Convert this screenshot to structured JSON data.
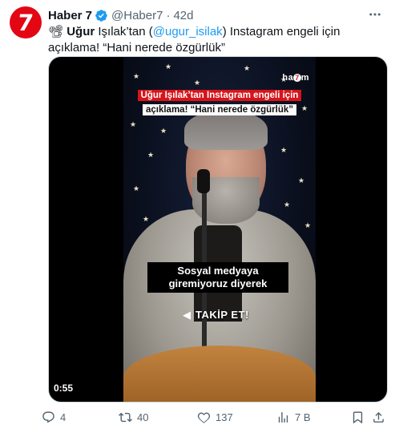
{
  "tweet": {
    "avatar_text": "7",
    "author_name": "Haber 7",
    "handle": "@Haber7",
    "separator": "·",
    "time": "42d",
    "text": {
      "emoji": "📽",
      "bold": "Uğur",
      "part1": " Işılak’tan (",
      "mention": "@ugur_isilak",
      "part2": ") Instagram engeli için açıklama! “Hani nerede özgürlük”"
    }
  },
  "video": {
    "overlay_line1": "Uğur Işılak’tan Instagram engeli için",
    "overlay_line2": "açıklama! “Hani nerede özgürlük”",
    "brand": "ha",
    "brand_mark": "7",
    "brand_tail": "m",
    "caption": "Sosyal medyaya giremiyoruz diyerek",
    "cta": "TAKİP ET!",
    "duration": "0:55"
  },
  "actions": {
    "replies": "4",
    "retweets": "40",
    "likes": "137",
    "views": "7 B"
  },
  "colors": {
    "accent": "#1d9bf0",
    "muted": "#536471",
    "brand_red": "#e30613"
  }
}
